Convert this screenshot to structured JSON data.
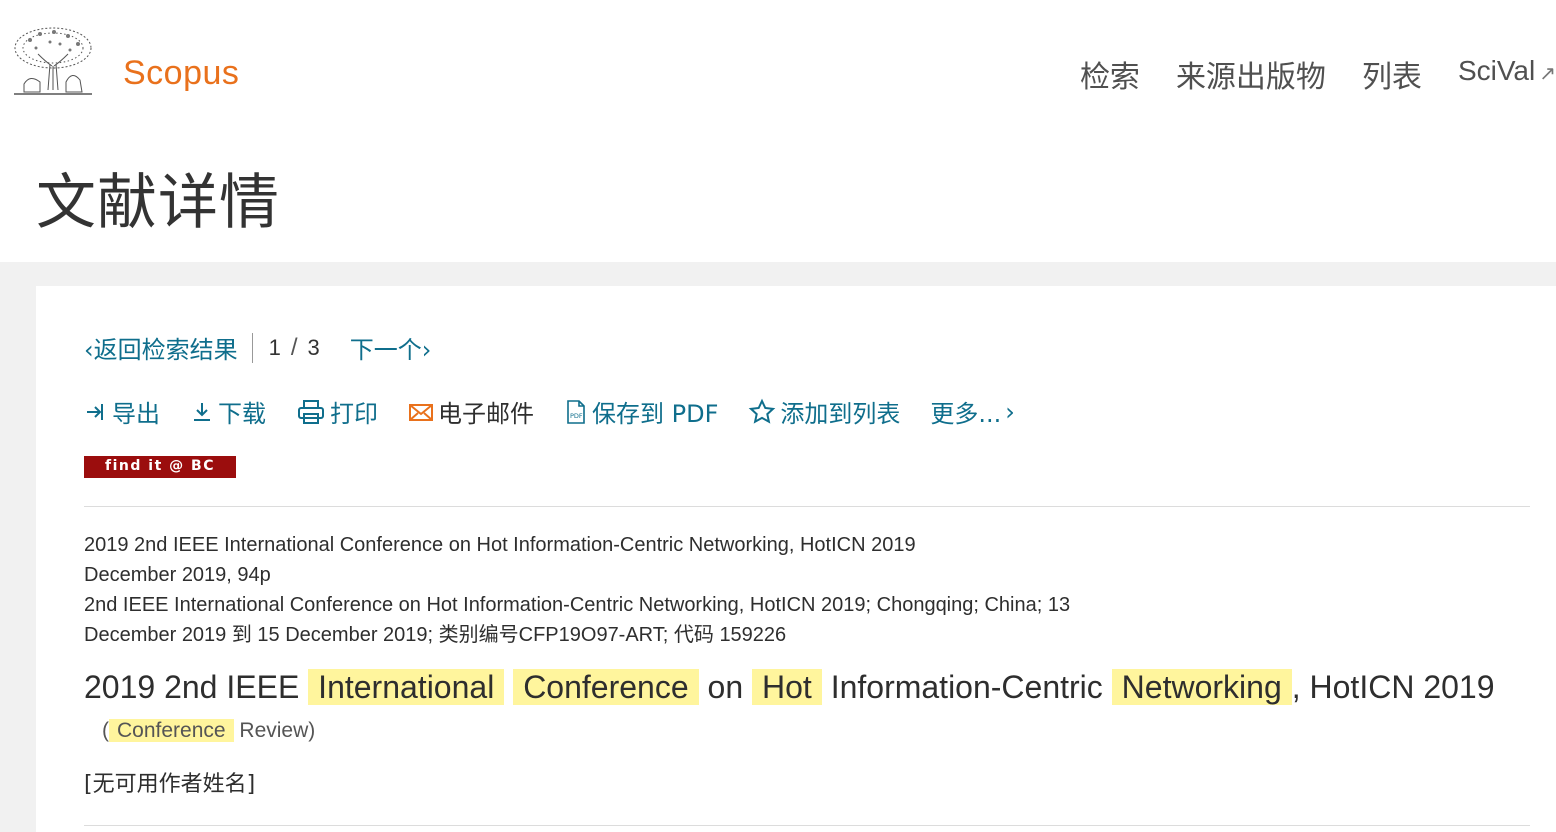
{
  "header": {
    "brand": "Scopus",
    "nav": [
      "检索",
      "来源出版物",
      "列表",
      "SciVal"
    ],
    "nav_external_icon": "external-link-icon"
  },
  "page_title": "文献详情",
  "result_nav": {
    "back_label": "返回检索结果",
    "current": "1",
    "total": "3",
    "next_label": "下一个"
  },
  "actions": [
    {
      "label": "导出",
      "icon": "export-icon"
    },
    {
      "label": "下载",
      "icon": "download-icon"
    },
    {
      "label": "打印",
      "icon": "print-icon"
    },
    {
      "label": "电子邮件",
      "icon": "email-icon"
    },
    {
      "label": "保存到 PDF",
      "icon": "pdf-icon"
    },
    {
      "label": "添加到列表",
      "icon": "star-icon"
    },
    {
      "label": "更多...",
      "icon": "chevron-right-icon"
    }
  ],
  "findit_label": "find it @ BC",
  "source": {
    "line1": "2019 2nd IEEE International Conference on Hot Information-Centric Networking, HotICN 2019",
    "line2": "December 2019, 94p",
    "line3": "2nd IEEE International Conference on Hot Information-Centric Networking, HotICN 2019; Chongqing; China; 13",
    "line4": "December 2019 到 15 December 2019; 类别编号CFP19O97-ART; 代码 159226"
  },
  "document": {
    "title_parts": [
      "2019 2nd IEEE",
      "International",
      "Conference",
      "on",
      "Hot",
      "Information-Centric",
      "Networking",
      ", HotICN",
      "2019"
    ],
    "doc_type_highlight": "Conference",
    "doc_type_rest": "Review)",
    "doc_type_open": "(",
    "authors": "[无可用作者姓名]"
  },
  "colors": {
    "brand": "#e9711c",
    "link": "#0f6e8c",
    "highlight": "#fff59d",
    "findit_bg": "#9b0d0d",
    "email_icon": "#e9711c"
  }
}
